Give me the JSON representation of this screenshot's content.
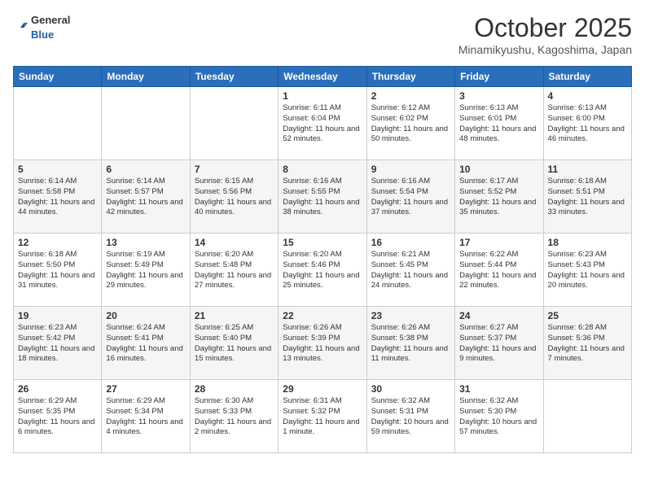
{
  "header": {
    "logo_general": "General",
    "logo_blue": "Blue",
    "month": "October 2025",
    "location": "Minamikyushu, Kagoshima, Japan"
  },
  "weekdays": [
    "Sunday",
    "Monday",
    "Tuesday",
    "Wednesday",
    "Thursday",
    "Friday",
    "Saturday"
  ],
  "weeks": [
    [
      {
        "day": "",
        "info": ""
      },
      {
        "day": "",
        "info": ""
      },
      {
        "day": "",
        "info": ""
      },
      {
        "day": "1",
        "info": "Sunrise: 6:11 AM\nSunset: 6:04 PM\nDaylight: 11 hours and 52 minutes."
      },
      {
        "day": "2",
        "info": "Sunrise: 6:12 AM\nSunset: 6:02 PM\nDaylight: 11 hours and 50 minutes."
      },
      {
        "day": "3",
        "info": "Sunrise: 6:13 AM\nSunset: 6:01 PM\nDaylight: 11 hours and 48 minutes."
      },
      {
        "day": "4",
        "info": "Sunrise: 6:13 AM\nSunset: 6:00 PM\nDaylight: 11 hours and 46 minutes."
      }
    ],
    [
      {
        "day": "5",
        "info": "Sunrise: 6:14 AM\nSunset: 5:58 PM\nDaylight: 11 hours and 44 minutes."
      },
      {
        "day": "6",
        "info": "Sunrise: 6:14 AM\nSunset: 5:57 PM\nDaylight: 11 hours and 42 minutes."
      },
      {
        "day": "7",
        "info": "Sunrise: 6:15 AM\nSunset: 5:56 PM\nDaylight: 11 hours and 40 minutes."
      },
      {
        "day": "8",
        "info": "Sunrise: 6:16 AM\nSunset: 5:55 PM\nDaylight: 11 hours and 38 minutes."
      },
      {
        "day": "9",
        "info": "Sunrise: 6:16 AM\nSunset: 5:54 PM\nDaylight: 11 hours and 37 minutes."
      },
      {
        "day": "10",
        "info": "Sunrise: 6:17 AM\nSunset: 5:52 PM\nDaylight: 11 hours and 35 minutes."
      },
      {
        "day": "11",
        "info": "Sunrise: 6:18 AM\nSunset: 5:51 PM\nDaylight: 11 hours and 33 minutes."
      }
    ],
    [
      {
        "day": "12",
        "info": "Sunrise: 6:18 AM\nSunset: 5:50 PM\nDaylight: 11 hours and 31 minutes."
      },
      {
        "day": "13",
        "info": "Sunrise: 6:19 AM\nSunset: 5:49 PM\nDaylight: 11 hours and 29 minutes."
      },
      {
        "day": "14",
        "info": "Sunrise: 6:20 AM\nSunset: 5:48 PM\nDaylight: 11 hours and 27 minutes."
      },
      {
        "day": "15",
        "info": "Sunrise: 6:20 AM\nSunset: 5:46 PM\nDaylight: 11 hours and 25 minutes."
      },
      {
        "day": "16",
        "info": "Sunrise: 6:21 AM\nSunset: 5:45 PM\nDaylight: 11 hours and 24 minutes."
      },
      {
        "day": "17",
        "info": "Sunrise: 6:22 AM\nSunset: 5:44 PM\nDaylight: 11 hours and 22 minutes."
      },
      {
        "day": "18",
        "info": "Sunrise: 6:23 AM\nSunset: 5:43 PM\nDaylight: 11 hours and 20 minutes."
      }
    ],
    [
      {
        "day": "19",
        "info": "Sunrise: 6:23 AM\nSunset: 5:42 PM\nDaylight: 11 hours and 18 minutes."
      },
      {
        "day": "20",
        "info": "Sunrise: 6:24 AM\nSunset: 5:41 PM\nDaylight: 11 hours and 16 minutes."
      },
      {
        "day": "21",
        "info": "Sunrise: 6:25 AM\nSunset: 5:40 PM\nDaylight: 11 hours and 15 minutes."
      },
      {
        "day": "22",
        "info": "Sunrise: 6:26 AM\nSunset: 5:39 PM\nDaylight: 11 hours and 13 minutes."
      },
      {
        "day": "23",
        "info": "Sunrise: 6:26 AM\nSunset: 5:38 PM\nDaylight: 11 hours and 11 minutes."
      },
      {
        "day": "24",
        "info": "Sunrise: 6:27 AM\nSunset: 5:37 PM\nDaylight: 11 hours and 9 minutes."
      },
      {
        "day": "25",
        "info": "Sunrise: 6:28 AM\nSunset: 5:36 PM\nDaylight: 11 hours and 7 minutes."
      }
    ],
    [
      {
        "day": "26",
        "info": "Sunrise: 6:29 AM\nSunset: 5:35 PM\nDaylight: 11 hours and 6 minutes."
      },
      {
        "day": "27",
        "info": "Sunrise: 6:29 AM\nSunset: 5:34 PM\nDaylight: 11 hours and 4 minutes."
      },
      {
        "day": "28",
        "info": "Sunrise: 6:30 AM\nSunset: 5:33 PM\nDaylight: 11 hours and 2 minutes."
      },
      {
        "day": "29",
        "info": "Sunrise: 6:31 AM\nSunset: 5:32 PM\nDaylight: 11 hours and 1 minute."
      },
      {
        "day": "30",
        "info": "Sunrise: 6:32 AM\nSunset: 5:31 PM\nDaylight: 10 hours and 59 minutes."
      },
      {
        "day": "31",
        "info": "Sunrise: 6:32 AM\nSunset: 5:30 PM\nDaylight: 10 hours and 57 minutes."
      },
      {
        "day": "",
        "info": ""
      }
    ]
  ]
}
